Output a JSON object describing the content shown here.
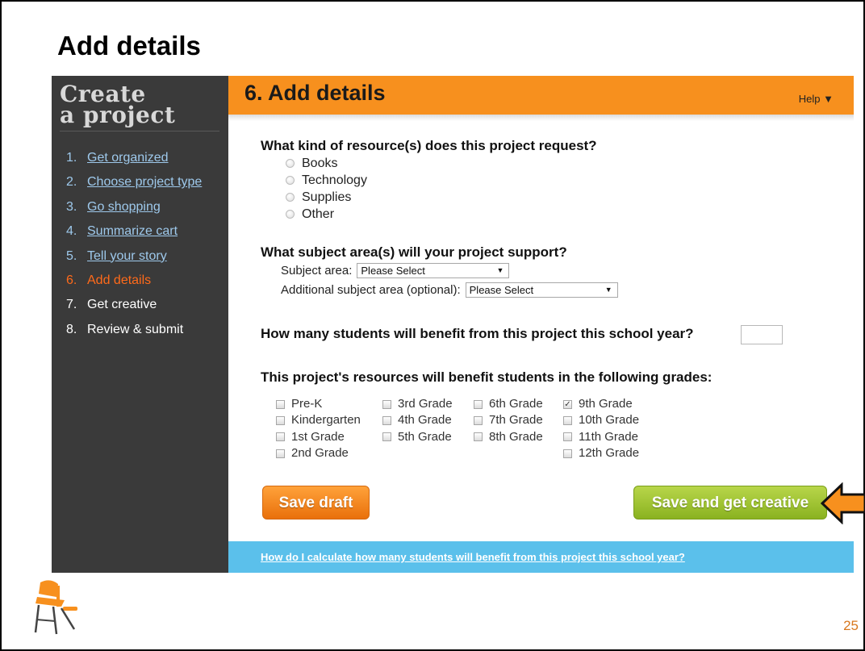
{
  "slide": {
    "title": "Add details",
    "page_number": "25"
  },
  "sidebar": {
    "brand_line1": "Create",
    "brand_line2": "a project",
    "steps": [
      {
        "num": "1.",
        "label": "Get organized",
        "state": "done"
      },
      {
        "num": "2.",
        "label": "Choose project type",
        "state": "done"
      },
      {
        "num": "3.",
        "label": "Go shopping",
        "state": "done"
      },
      {
        "num": "4.",
        "label": "Summarize cart",
        "state": "done"
      },
      {
        "num": "5.",
        "label": "Tell your story",
        "state": "done"
      },
      {
        "num": "6.",
        "label": "Add details",
        "state": "current"
      },
      {
        "num": "7.",
        "label": "Get creative",
        "state": "future"
      },
      {
        "num": "8.",
        "label": "Review & submit",
        "state": "future"
      }
    ]
  },
  "header": {
    "title": "6. Add details",
    "help_label": "Help",
    "help_icon": "caret-down-icon"
  },
  "resources": {
    "question": "What kind of resource(s) does this project request?",
    "options": [
      "Books",
      "Technology",
      "Supplies",
      "Other"
    ],
    "selected": null
  },
  "subject": {
    "question": "What subject area(s) will your project support?",
    "primary_label": "Subject area:",
    "primary_value": "Please Select",
    "additional_label": "Additional subject area (optional):",
    "additional_value": "Please Select"
  },
  "students": {
    "question": "How many students will benefit from this project this school year?",
    "value": ""
  },
  "grades": {
    "question": "This project's resources will benefit students in the following grades:",
    "columns": [
      [
        {
          "label": "Pre-K",
          "checked": false
        },
        {
          "label": "Kindergarten",
          "checked": false
        },
        {
          "label": "1st Grade",
          "checked": false
        },
        {
          "label": "2nd Grade",
          "checked": false
        }
      ],
      [
        {
          "label": "3rd Grade",
          "checked": false
        },
        {
          "label": "4th Grade",
          "checked": false
        },
        {
          "label": "5th Grade",
          "checked": false
        }
      ],
      [
        {
          "label": "6th Grade",
          "checked": false
        },
        {
          "label": "7th Grade",
          "checked": false
        },
        {
          "label": "8th Grade",
          "checked": false
        }
      ],
      [
        {
          "label": "9th Grade",
          "checked": true
        },
        {
          "label": "10th Grade",
          "checked": false
        },
        {
          "label": "11th Grade",
          "checked": false
        },
        {
          "label": "12th Grade",
          "checked": false
        }
      ]
    ]
  },
  "actions": {
    "save_draft": "Save draft",
    "save_and_continue": "Save and get creative"
  },
  "footer": {
    "link": "How do I calculate how many students will benefit from this project this school year?"
  },
  "colors": {
    "accent_orange": "#f7901e",
    "sidebar_dark": "#3a3a3a",
    "link_blue": "#9ec9ec",
    "current_step": "#ff6a1a",
    "save_green": "#8ab220",
    "footer_blue": "#5bc0eb"
  }
}
